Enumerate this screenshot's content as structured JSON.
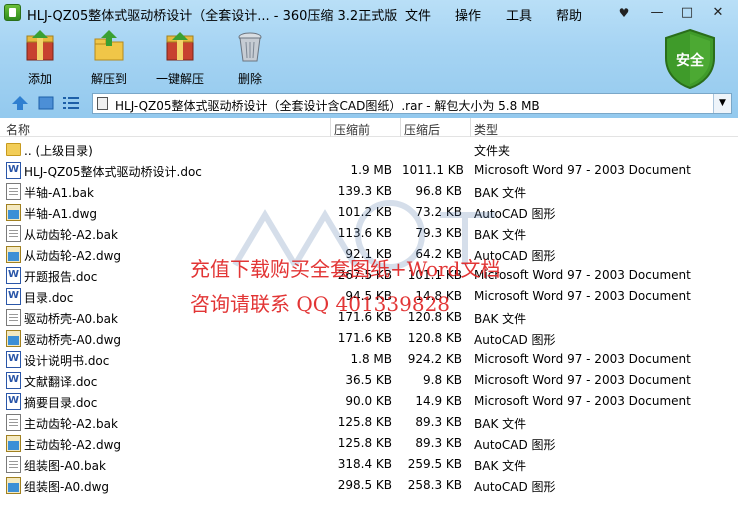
{
  "window": {
    "title": "HLJ-QZ05整体式驱动桥设计（全套设计... - 360压缩 3.2正式版",
    "menus": [
      "文件",
      "操作",
      "工具",
      "帮助"
    ],
    "controls": [
      "—",
      "□",
      "✕"
    ]
  },
  "toolbar": {
    "add_label": "添加",
    "extract_label": "解压到",
    "one_click_label": "一键解压",
    "delete_label": "删除",
    "security_label": "安全"
  },
  "address": {
    "path": "HLJ-QZ05整体式驱动桥设计（全套设计含CAD图纸）.rar - 解包大小为 5.8 MB"
  },
  "columns": {
    "name": "名称",
    "size": "压缩前",
    "packed": "压缩后",
    "type": "类型"
  },
  "files": [
    {
      "icon": "folder",
      "name": ".. (上级目录)",
      "size": "",
      "packed": "",
      "type": "文件夹"
    },
    {
      "icon": "doc",
      "name": "HLJ-QZ05整体式驱动桥设计.doc",
      "size": "1.9 MB",
      "packed": "1011.1 KB",
      "type": "Microsoft Word 97 - 2003 Document"
    },
    {
      "icon": "bak",
      "name": "半轴-A1.bak",
      "size": "139.3 KB",
      "packed": "96.8 KB",
      "type": "BAK 文件"
    },
    {
      "icon": "dwg",
      "name": "半轴-A1.dwg",
      "size": "101.2 KB",
      "packed": "73.2 KB",
      "type": "AutoCAD 图形"
    },
    {
      "icon": "bak",
      "name": "从动齿轮-A2.bak",
      "size": "113.6 KB",
      "packed": "79.3 KB",
      "type": "BAK 文件"
    },
    {
      "icon": "dwg",
      "name": "从动齿轮-A2.dwg",
      "size": "92.1 KB",
      "packed": "64.2 KB",
      "type": "AutoCAD 图形"
    },
    {
      "icon": "doc",
      "name": "开题报告.doc",
      "size": "267.5 KB",
      "packed": "101.1 KB",
      "type": "Microsoft Word 97 - 2003 Document"
    },
    {
      "icon": "doc",
      "name": "目录.doc",
      "size": "94.5 KB",
      "packed": "14.8 KB",
      "type": "Microsoft Word 97 - 2003 Document"
    },
    {
      "icon": "bak",
      "name": "驱动桥壳-A0.bak",
      "size": "171.6 KB",
      "packed": "120.8 KB",
      "type": "BAK 文件"
    },
    {
      "icon": "dwg",
      "name": "驱动桥壳-A0.dwg",
      "size": "171.6 KB",
      "packed": "120.8 KB",
      "type": "AutoCAD 图形"
    },
    {
      "icon": "doc",
      "name": "设计说明书.doc",
      "size": "1.8 MB",
      "packed": "924.2 KB",
      "type": "Microsoft Word 97 - 2003 Document"
    },
    {
      "icon": "doc",
      "name": "文献翻译.doc",
      "size": "36.5 KB",
      "packed": "9.8 KB",
      "type": "Microsoft Word 97 - 2003 Document"
    },
    {
      "icon": "doc",
      "name": "摘要目录.doc",
      "size": "90.0 KB",
      "packed": "14.9 KB",
      "type": "Microsoft Word 97 - 2003 Document"
    },
    {
      "icon": "bak",
      "name": "主动齿轮-A2.bak",
      "size": "125.8 KB",
      "packed": "89.3 KB",
      "type": "BAK 文件"
    },
    {
      "icon": "dwg",
      "name": "主动齿轮-A2.dwg",
      "size": "125.8 KB",
      "packed": "89.3 KB",
      "type": "AutoCAD 图形"
    },
    {
      "icon": "bak",
      "name": "组装图-A0.bak",
      "size": "318.4 KB",
      "packed": "259.5 KB",
      "type": "BAK 文件"
    },
    {
      "icon": "dwg",
      "name": "组装图-A0.dwg",
      "size": "298.5 KB",
      "packed": "258.3 KB",
      "type": "AutoCAD 图形"
    }
  ],
  "watermark": {
    "line1": "充值下载购买全套图纸+Word文档",
    "line2": "咨询请联系 QQ 401339828"
  },
  "colors": {
    "chrome": "#a6d4f3",
    "watermark": "#e02424",
    "security_shield": "#3f9b2a"
  }
}
